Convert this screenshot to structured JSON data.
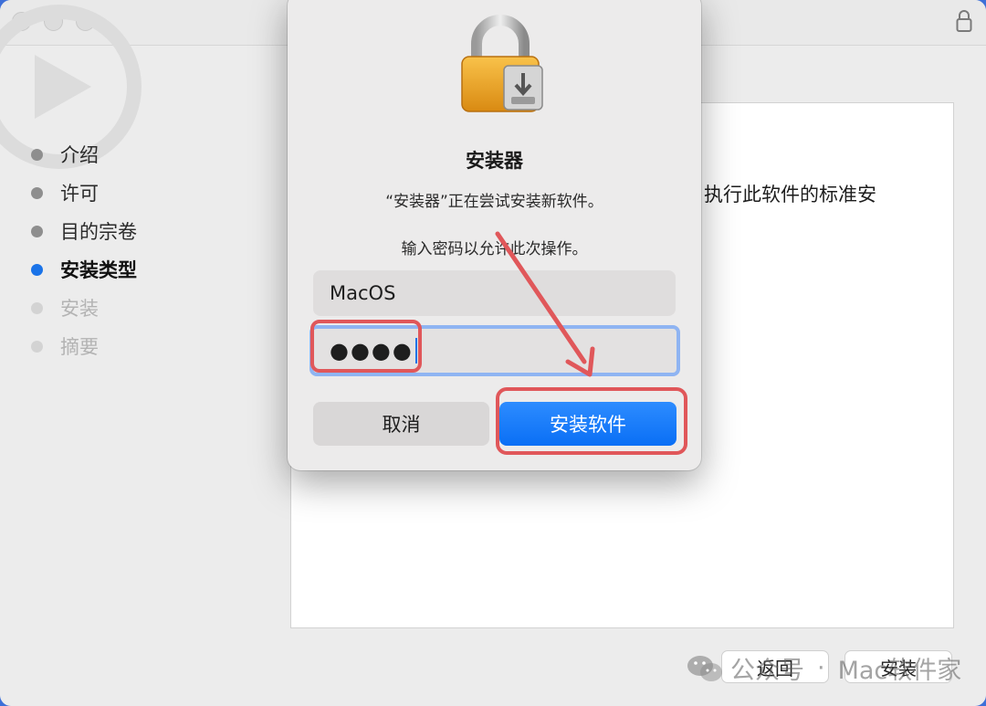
{
  "window": {
    "sidebar": {
      "steps": [
        {
          "label": "介绍",
          "state": "done"
        },
        {
          "label": "许可",
          "state": "done"
        },
        {
          "label": "目的宗卷",
          "state": "done"
        },
        {
          "label": "安装类型",
          "state": "active"
        },
        {
          "label": "安装",
          "state": "future"
        },
        {
          "label": "摘要",
          "state": "future"
        }
      ]
    },
    "content_text": "执行此软件的标准安",
    "buttons": {
      "back": "返回",
      "install": "安装"
    }
  },
  "watermark": {
    "part1": "公众号",
    "separator": "·",
    "part2": "Mac软件家"
  },
  "dialog": {
    "title": "安装器",
    "message": "“安装器”正在尝试安装新软件。",
    "prompt": "输入密码以允许此次操作。",
    "username": "MacOS",
    "password_mask": "●●●●",
    "cancel_label": "取消",
    "confirm_label": "安装软件"
  },
  "colors": {
    "accent": "#1a73e8",
    "highlight": "#e0575a",
    "confirm_button": "#0a6ff5"
  }
}
